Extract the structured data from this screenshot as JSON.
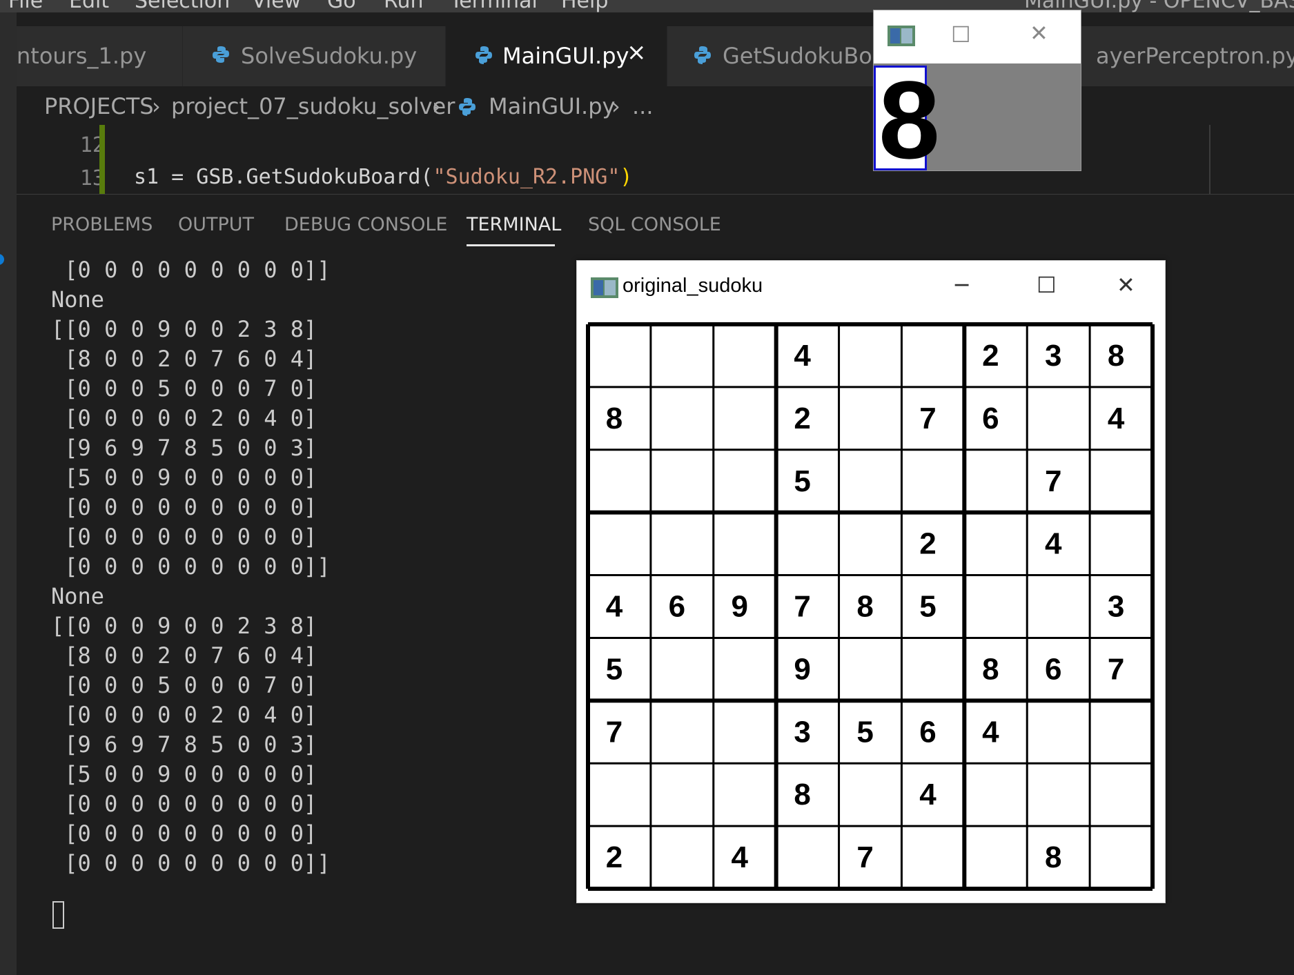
{
  "menubar": {
    "items": [
      "File",
      "Edit",
      "Selection",
      "View",
      "Go",
      "Run",
      "Terminal",
      "Help"
    ],
    "window_title": "MainGUI.py - OPENCV_BASIC"
  },
  "tabs": [
    {
      "label": "ntours_1.py",
      "icon": "none",
      "active": false
    },
    {
      "label": "SolveSudoku.py",
      "icon": "python-icon",
      "active": false
    },
    {
      "label": "MainGUI.py",
      "icon": "python-icon",
      "active": true,
      "close": "×"
    },
    {
      "label": "GetSudokuBoar",
      "icon": "python-icon",
      "active": false
    },
    {
      "label": "ayerPerceptron.py",
      "icon": "none",
      "active": false
    }
  ],
  "breadcrumb": {
    "root": "PROJECTS",
    "folder": "project_07_sudoku_solver",
    "file": "MainGUI.py",
    "more": "..."
  },
  "editor": {
    "lines": [
      {
        "number": "12",
        "code": ""
      },
      {
        "number": "13",
        "code_prefix": "s1 = GSB.GetSudokuBoard(",
        "code_string": "\"Sudoku_R2.PNG\"",
        "code_suffix": ")"
      }
    ]
  },
  "panel": {
    "tabs": [
      "PROBLEMS",
      "OUTPUT",
      "DEBUG CONSOLE",
      "TERMINAL",
      "SQL CONSOLE"
    ],
    "active_tab": "TERMINAL"
  },
  "terminal": {
    "lines": [
      " [0 0 0 0 0 0 0 0 0]]",
      "None",
      "[[0 0 0 9 0 0 2 3 8]",
      " [8 0 0 2 0 7 6 0 4]",
      " [0 0 0 5 0 0 0 7 0]",
      " [0 0 0 0 0 2 0 4 0]",
      " [9 6 9 7 8 5 0 0 3]",
      " [5 0 0 9 0 0 0 0 0]",
      " [0 0 0 0 0 0 0 0 0]",
      " [0 0 0 0 0 0 0 0 0]",
      " [0 0 0 0 0 0 0 0 0]]",
      "None",
      "[[0 0 0 9 0 0 2 3 8]",
      " [8 0 0 2 0 7 6 0 4]",
      " [0 0 0 5 0 0 0 7 0]",
      " [0 0 0 0 0 2 0 4 0]",
      " [9 6 9 7 8 5 0 0 3]",
      " [5 0 0 9 0 0 0 0 0]",
      " [0 0 0 0 0 0 0 0 0]",
      " [0 0 0 0 0 0 0 0 0]",
      " [0 0 0 0 0 0 0 0 0]]"
    ]
  },
  "digit_window": {
    "digit": "8",
    "minimize": "─",
    "maximize": "☐",
    "close": "✕"
  },
  "sudoku_window": {
    "title": "original_sudoku",
    "minimize": "─",
    "maximize": "☐",
    "close": "✕",
    "grid": [
      [
        "",
        "",
        "",
        "4",
        "",
        "",
        "2",
        "3",
        "8"
      ],
      [
        "8",
        "",
        "",
        "2",
        "",
        "7",
        "6",
        "",
        "4"
      ],
      [
        "",
        "",
        "",
        "5",
        "",
        "",
        "",
        "7",
        ""
      ],
      [
        "",
        "",
        "",
        "",
        "",
        "2",
        "",
        "4",
        ""
      ],
      [
        "4",
        "6",
        "9",
        "7",
        "8",
        "5",
        "",
        "",
        "3"
      ],
      [
        "5",
        "",
        "",
        "9",
        "",
        "",
        "8",
        "6",
        "7"
      ],
      [
        "7",
        "",
        "",
        "3",
        "5",
        "6",
        "4",
        "",
        ""
      ],
      [
        "",
        "",
        "",
        "8",
        "",
        "4",
        "",
        "",
        ""
      ],
      [
        "2",
        "",
        "4",
        "",
        "7",
        "",
        "",
        "8",
        ""
      ]
    ]
  },
  "colors": {
    "editor_bg": "#1e1e1e",
    "tab_bg": "#2d2d2d",
    "string_color": "#ce9178",
    "paren_color": "#ffd700",
    "git_modified": "#587c0c"
  }
}
